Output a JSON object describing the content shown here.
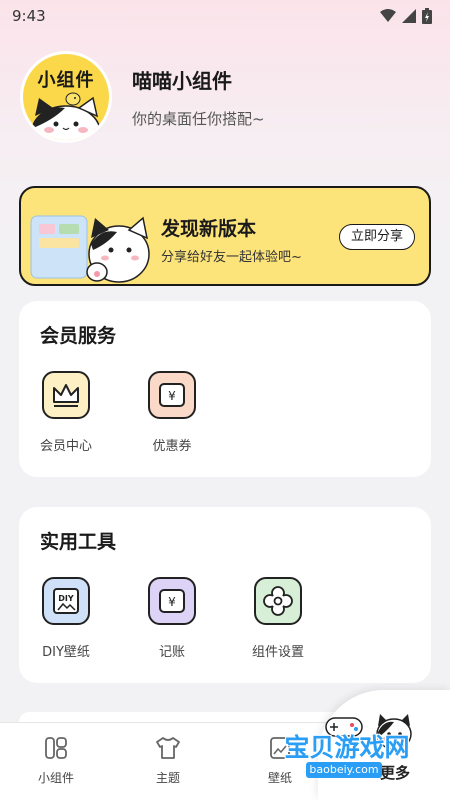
{
  "status_bar": {
    "time": "9:43"
  },
  "profile": {
    "avatar_text": "小组件",
    "name": "喵喵小组件",
    "motto": "你的桌面任你搭配~"
  },
  "promo": {
    "title": "发现新版本",
    "subtitle": "分享给好友一起体验吧~",
    "button": "立即分享"
  },
  "member_card": {
    "title": "会员服务",
    "items": [
      {
        "label": "会员中心",
        "icon": "crown-icon",
        "color": "#fdf0c4"
      },
      {
        "label": "优惠券",
        "icon": "coupon-icon",
        "color": "#fbd9c9"
      }
    ]
  },
  "tools_card": {
    "title": "实用工具",
    "items": [
      {
        "label": "DIY壁纸",
        "icon": "diy-wallpaper-icon",
        "color": "#cfe1f8",
        "glyph": "DIY"
      },
      {
        "label": "记账",
        "icon": "bookkeeping-icon",
        "color": "#ddd3f6",
        "glyph": "¥"
      },
      {
        "label": "组件设置",
        "icon": "settings-flower-icon",
        "color": "#d6efd6"
      }
    ]
  },
  "tabbar": {
    "tabs": [
      {
        "label": "小组件",
        "icon": "widgets-icon"
      },
      {
        "label": "主题",
        "icon": "tshirt-icon"
      },
      {
        "label": "壁纸",
        "icon": "wallpaper-icon"
      }
    ],
    "more_label": "更多"
  },
  "watermark": {
    "text": "宝贝游戏网",
    "url": "baobeiy.com"
  },
  "colors": {
    "accent_yellow": "#fde47a",
    "avatar_yellow": "#fbd74a",
    "watermark_blue": "#2a9df4"
  }
}
